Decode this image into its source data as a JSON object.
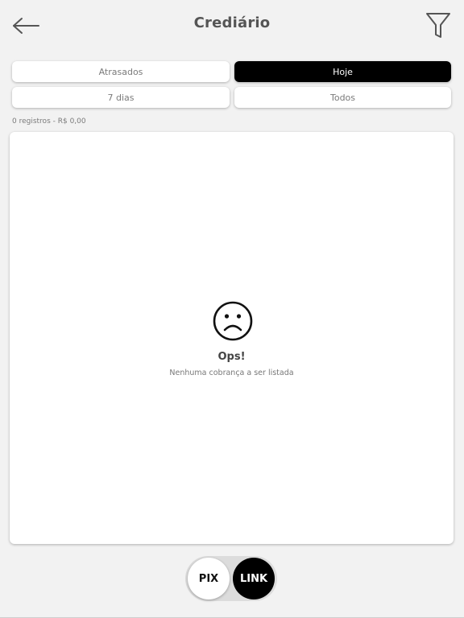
{
  "header": {
    "title": "Crediário",
    "back_icon": "arrow-left-icon",
    "filter_icon": "filter-icon"
  },
  "filters": {
    "atrasados": "Atrasados",
    "hoje": "Hoje",
    "sete_dias": "7 dias",
    "todos": "Todos",
    "selected": "Hoje"
  },
  "summary": "0 registros - R$ 0,00",
  "empty_state": {
    "icon": "sad-face-icon",
    "title": "Ops!",
    "message": "Nenhuma cobrança a ser listada"
  },
  "payment_toggle": {
    "pix_label": "PIX",
    "link_label": "LINK",
    "selected": "LINK"
  },
  "colors": {
    "background": "#f2f2f2",
    "active": "#000000",
    "card": "#ffffff",
    "text_muted": "#7a7a7a"
  }
}
